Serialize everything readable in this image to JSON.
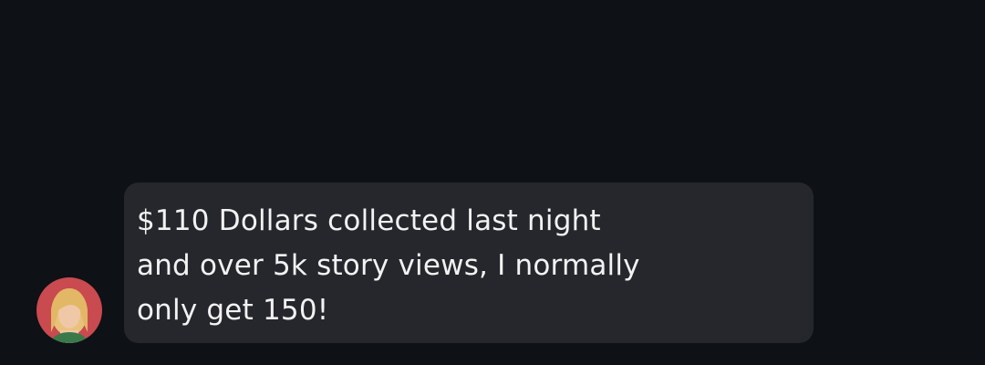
{
  "conversation": {
    "message": {
      "lines": [
        "$110 Dollars collected last night",
        "and over 5k story views, I normally",
        "only get 150!"
      ],
      "sender_avatar": "user-avatar-photo"
    }
  },
  "colors": {
    "background": "#0e1116",
    "bubble": "#25272c",
    "text": "#f2f2f2"
  }
}
